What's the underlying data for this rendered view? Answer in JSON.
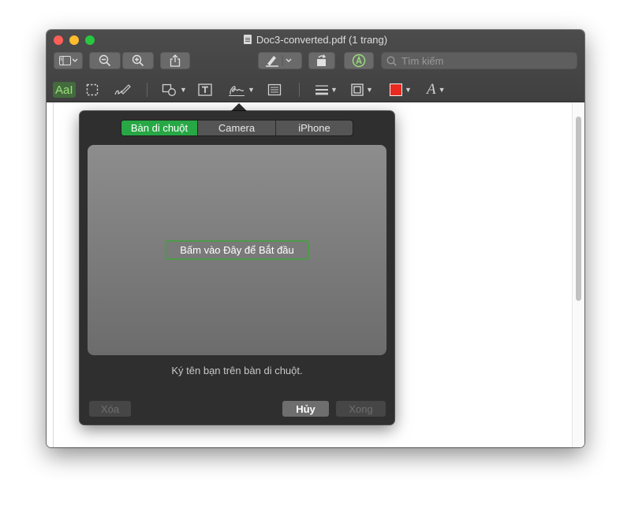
{
  "window": {
    "title": "Doc3-converted.pdf (1 trang)"
  },
  "toolbar": {
    "search_placeholder": "Tìm kiếm",
    "markup_text_label": "AaI",
    "icons": [
      "sidebar-icon",
      "zoom-out-icon",
      "zoom-in-icon",
      "share-icon",
      "highlight-pen-icon",
      "rotate-icon",
      "markup-icon",
      "search-icon"
    ]
  },
  "markup_bar": {
    "border_color_value": "#e82a21",
    "icons": [
      "text-selection-icon",
      "rect-selection-icon",
      "sketch-icon",
      "shapes-icon",
      "text-box-icon",
      "signature-icon",
      "note-icon",
      "line-style-icon",
      "border-color-icon",
      "fill-color-icon",
      "font-icon"
    ]
  },
  "signature_panel": {
    "tabs": [
      {
        "label": "Bàn di chuột",
        "active": true
      },
      {
        "label": "Camera",
        "active": false
      },
      {
        "label": "iPhone",
        "active": false
      }
    ],
    "start_button": "Bấm vào Đây để Bắt đầu",
    "hint": "Ký tên bạn trên bàn di chuột.",
    "clear_button": "Xóa",
    "cancel_button": "Hủy",
    "done_button": "Xong",
    "accent_color": "#28a745"
  }
}
